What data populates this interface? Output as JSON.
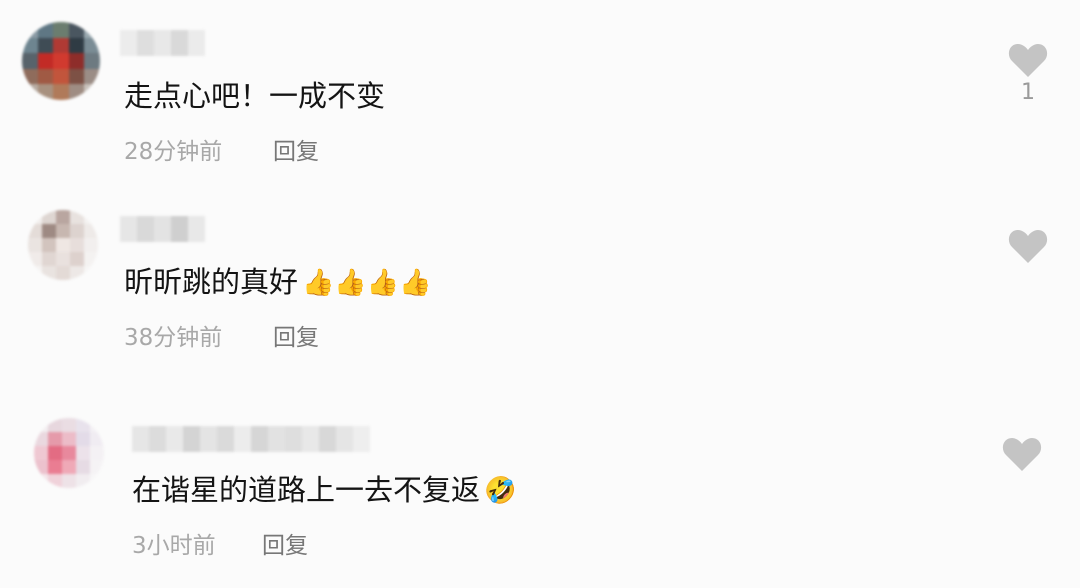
{
  "comments": [
    {
      "text": "走点心吧！一成不变",
      "time": "28分钟前",
      "reply_label": "回复",
      "likes": "1",
      "emoji": "",
      "like_icon": "heart-icon"
    },
    {
      "text": "昕昕跳的真好",
      "time": "38分钟前",
      "reply_label": "回复",
      "likes": "",
      "emoji": "👍👍👍👍",
      "like_icon": "heart-icon"
    },
    {
      "text": "在谐星的道路上一去不复返",
      "time": "3小时前",
      "reply_label": "回复",
      "likes": "",
      "emoji": "🤣",
      "like_icon": "heart-icon"
    }
  ],
  "colors": {
    "background": "#fbfbfb",
    "text": "#141414",
    "meta": "#a8a8a8",
    "heart": "#c4c4c4"
  }
}
